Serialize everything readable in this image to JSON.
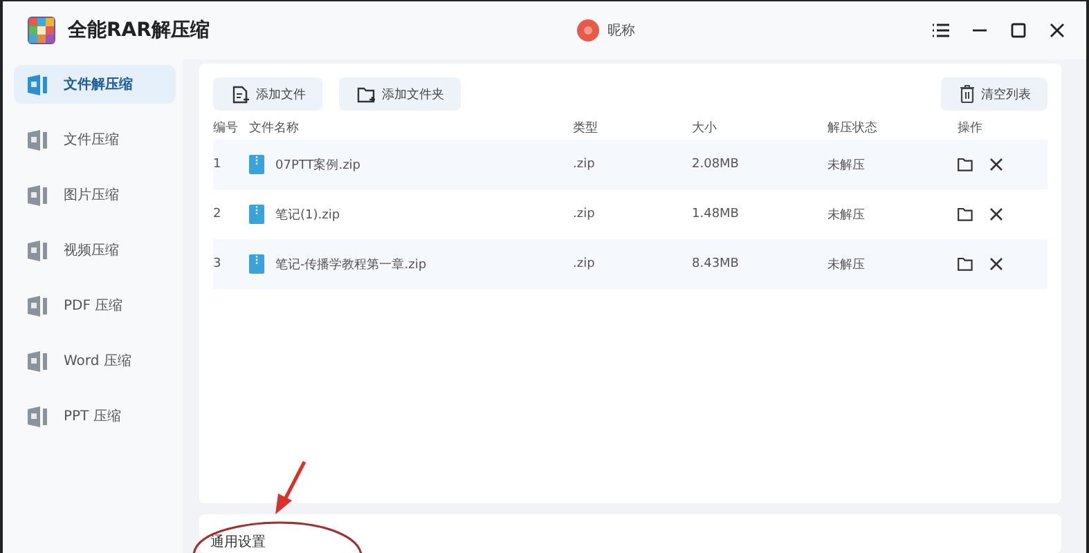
{
  "window": {
    "title": "全能RAR解压缩",
    "user": "昵称"
  },
  "sidebar": {
    "items": [
      {
        "label": "文件解压缩",
        "selected": true
      },
      {
        "label": "文件压缩",
        "selected": false
      },
      {
        "label": "图片压缩",
        "selected": false
      },
      {
        "label": "视频压缩",
        "selected": false
      },
      {
        "label": "PDF 压缩",
        "selected": false
      },
      {
        "label": "Word 压缩",
        "selected": false
      },
      {
        "label": "PPT 压缩",
        "selected": false
      }
    ]
  },
  "toolbar": {
    "buttons": [
      "添加文件",
      "添加文件夹"
    ],
    "clear": "清空列表"
  },
  "table": {
    "columns": [
      "编号",
      "文件名称",
      "类型",
      "大小",
      "解压状态",
      "操作"
    ],
    "rows": [
      {
        "index": "1",
        "name": "07PTT案例.zip",
        "type": ".zip",
        "size": "2.08MB",
        "status": "未解压"
      },
      {
        "index": "2",
        "name": "笔记(1).zip",
        "type": ".zip",
        "size": "1.48MB",
        "status": "未解压"
      },
      {
        "index": "3",
        "name": "笔记-传播学教程第一章.zip",
        "type": ".zip",
        "size": "8.43MB",
        "status": "未解压"
      }
    ]
  },
  "settings": {
    "title": "通用设置"
  }
}
